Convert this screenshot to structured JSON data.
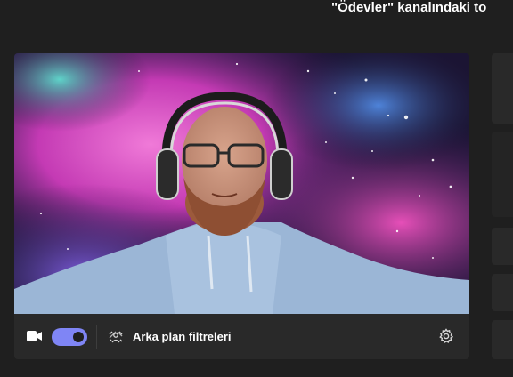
{
  "header": {
    "title": "\"Ödevler\" kanalındaki to"
  },
  "device_controls": {
    "camera_icon": "video-camera-icon",
    "camera_toggle_on": true,
    "background_filters_icon": "background-effects-icon",
    "background_filters_label": "Arka plan filtreleri",
    "settings_icon": "gear-icon"
  },
  "colors": {
    "app_background": "#1f1f1f",
    "card_background": "#292929",
    "toggle_accent": "#7f85f5"
  }
}
